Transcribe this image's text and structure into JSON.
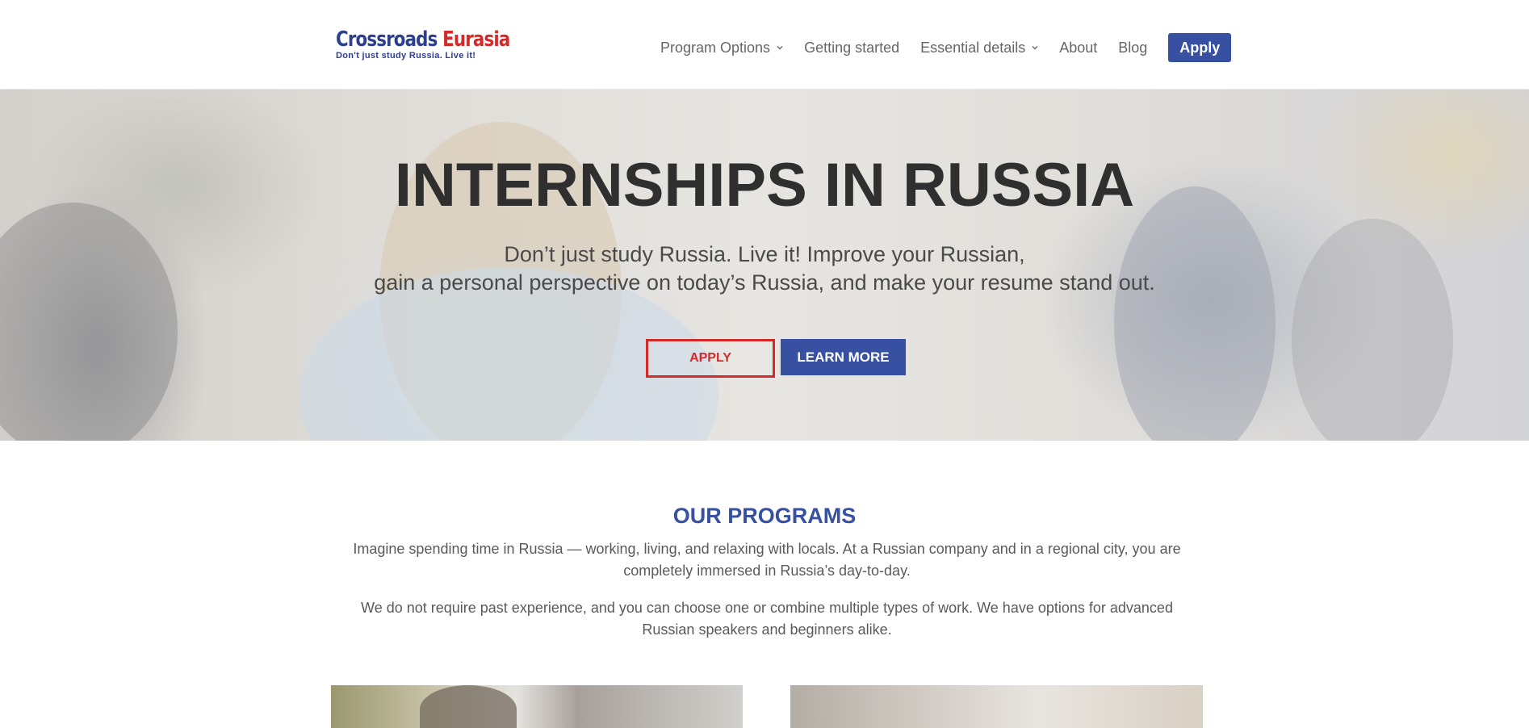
{
  "brand": {
    "name_main": "Crossroads",
    "name_accent": "Eurasia",
    "tagline": "Don't just study Russia. Live it!",
    "colors": {
      "primary": "#3750a1",
      "accent": "#d32a2a"
    }
  },
  "nav": {
    "items": [
      {
        "label": "Program Options",
        "dropdown": true
      },
      {
        "label": "Getting started",
        "dropdown": false
      },
      {
        "label": "Essential details",
        "dropdown": true
      },
      {
        "label": "About",
        "dropdown": false
      },
      {
        "label": "Blog",
        "dropdown": false
      }
    ],
    "apply_label": "Apply"
  },
  "hero": {
    "title": "INTERNSHIPS IN RUSSIA",
    "subtitle_line1": "Don’t just study Russia. Live it! Improve your Russian,",
    "subtitle_line2": "gain a personal perspective on today’s Russia, and make your resume stand out.",
    "apply_button": "APPLY",
    "learn_more_button": "LEARN MORE"
  },
  "programs": {
    "title": "OUR PROGRAMS",
    "paragraph1": "Imagine spending time in Russia — working, living, and relaxing with locals. At a Russian company and in a regional city, you are completely immersed in Russia’s day-to-day.",
    "paragraph2": "We do not require past experience, and you can choose one or combine multiple types of work. We have options for advanced Russian speakers and beginners alike."
  }
}
